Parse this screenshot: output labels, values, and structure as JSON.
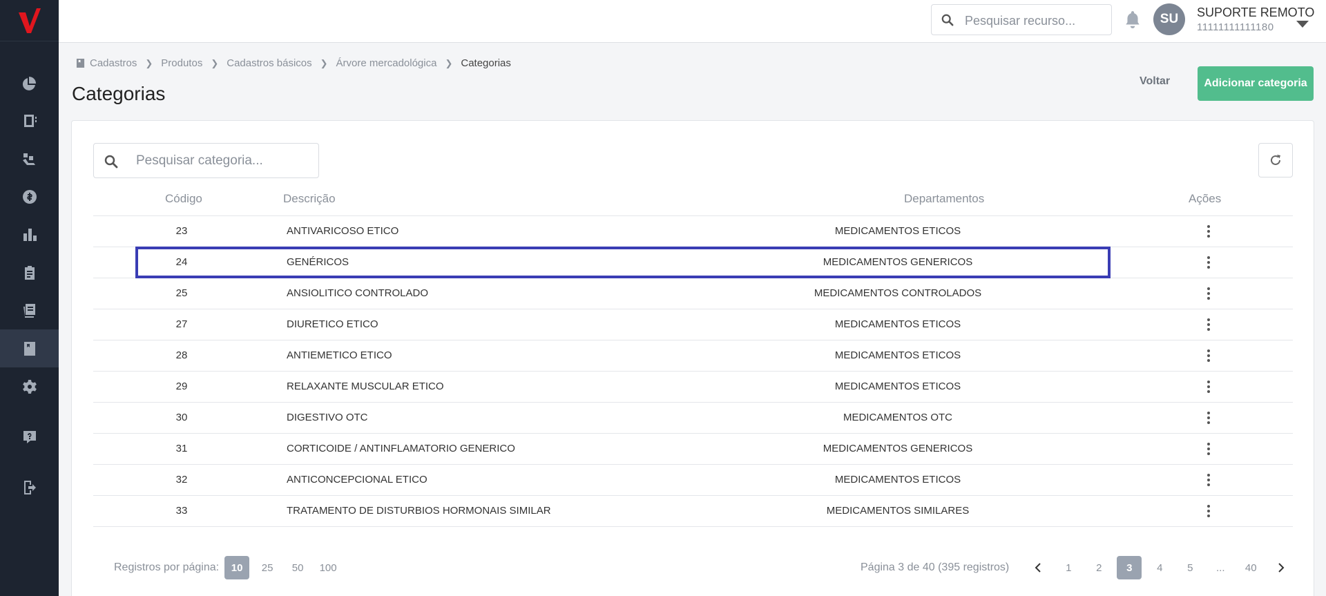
{
  "brand": {
    "logo": "V",
    "accent": "#e0161e"
  },
  "sidebar": {
    "items": [
      {
        "name": "dashboard-icon"
      },
      {
        "name": "notebook-icon"
      },
      {
        "name": "logistics-icon"
      },
      {
        "name": "finance-icon"
      },
      {
        "name": "reports-icon"
      },
      {
        "name": "clipboard-icon"
      },
      {
        "name": "invoices-icon"
      },
      {
        "name": "book-icon",
        "active": true
      },
      {
        "name": "settings-icon"
      },
      {
        "name": "help-icon"
      },
      {
        "name": "logout-icon"
      }
    ]
  },
  "header": {
    "search_placeholder": "Pesquisar recurso...",
    "user_initials": "SU",
    "user_name": "SUPORTE REMOTO",
    "user_id": "11111111111180"
  },
  "breadcrumb": [
    "Cadastros",
    "Produtos",
    "Cadastros básicos",
    "Árvore mercadológica",
    "Categorias"
  ],
  "page": {
    "title": "Categorias",
    "back_label": "Voltar",
    "add_label": "Adicionar categoria"
  },
  "table": {
    "search_placeholder": "Pesquisar categoria...",
    "columns": {
      "code": "Código",
      "desc": "Descrição",
      "dept": "Departamentos",
      "actions": "Ações"
    },
    "rows": [
      {
        "code": "23",
        "desc": "ANTIVARICOSO ETICO",
        "dept": "MEDICAMENTOS ETICOS"
      },
      {
        "code": "24",
        "desc": "GENÉRICOS",
        "dept": "MEDICAMENTOS GENERICOS"
      },
      {
        "code": "25",
        "desc": "ANSIOLITICO CONTROLADO",
        "dept": "MEDICAMENTOS CONTROLADOS"
      },
      {
        "code": "27",
        "desc": "DIURETICO ETICO",
        "dept": "MEDICAMENTOS ETICOS"
      },
      {
        "code": "28",
        "desc": "ANTIEMETICO ETICO",
        "dept": "MEDICAMENTOS ETICOS"
      },
      {
        "code": "29",
        "desc": "RELAXANTE MUSCULAR ETICO",
        "dept": "MEDICAMENTOS ETICOS"
      },
      {
        "code": "30",
        "desc": "DIGESTIVO OTC",
        "dept": "MEDICAMENTOS OTC"
      },
      {
        "code": "31",
        "desc": "CORTICOIDE / ANTINFLAMATORIO GENERICO",
        "dept": "MEDICAMENTOS GENERICOS"
      },
      {
        "code": "32",
        "desc": "ANTICONCEPCIONAL ETICO",
        "dept": "MEDICAMENTOS ETICOS"
      },
      {
        "code": "33",
        "desc": "TRATAMENTO DE DISTURBIOS HORMONAIS SIMILAR",
        "dept": "MEDICAMENTOS SIMILARES"
      }
    ]
  },
  "pagination": {
    "per_page_label": "Registros por página:",
    "per_page_options": [
      "10",
      "25",
      "50",
      "100"
    ],
    "per_page_selected": "10",
    "info": "Página 3 de 40 (395 registros)",
    "pages": [
      "1",
      "2",
      "3",
      "4",
      "5",
      "...",
      "40"
    ],
    "current_page": "3"
  }
}
